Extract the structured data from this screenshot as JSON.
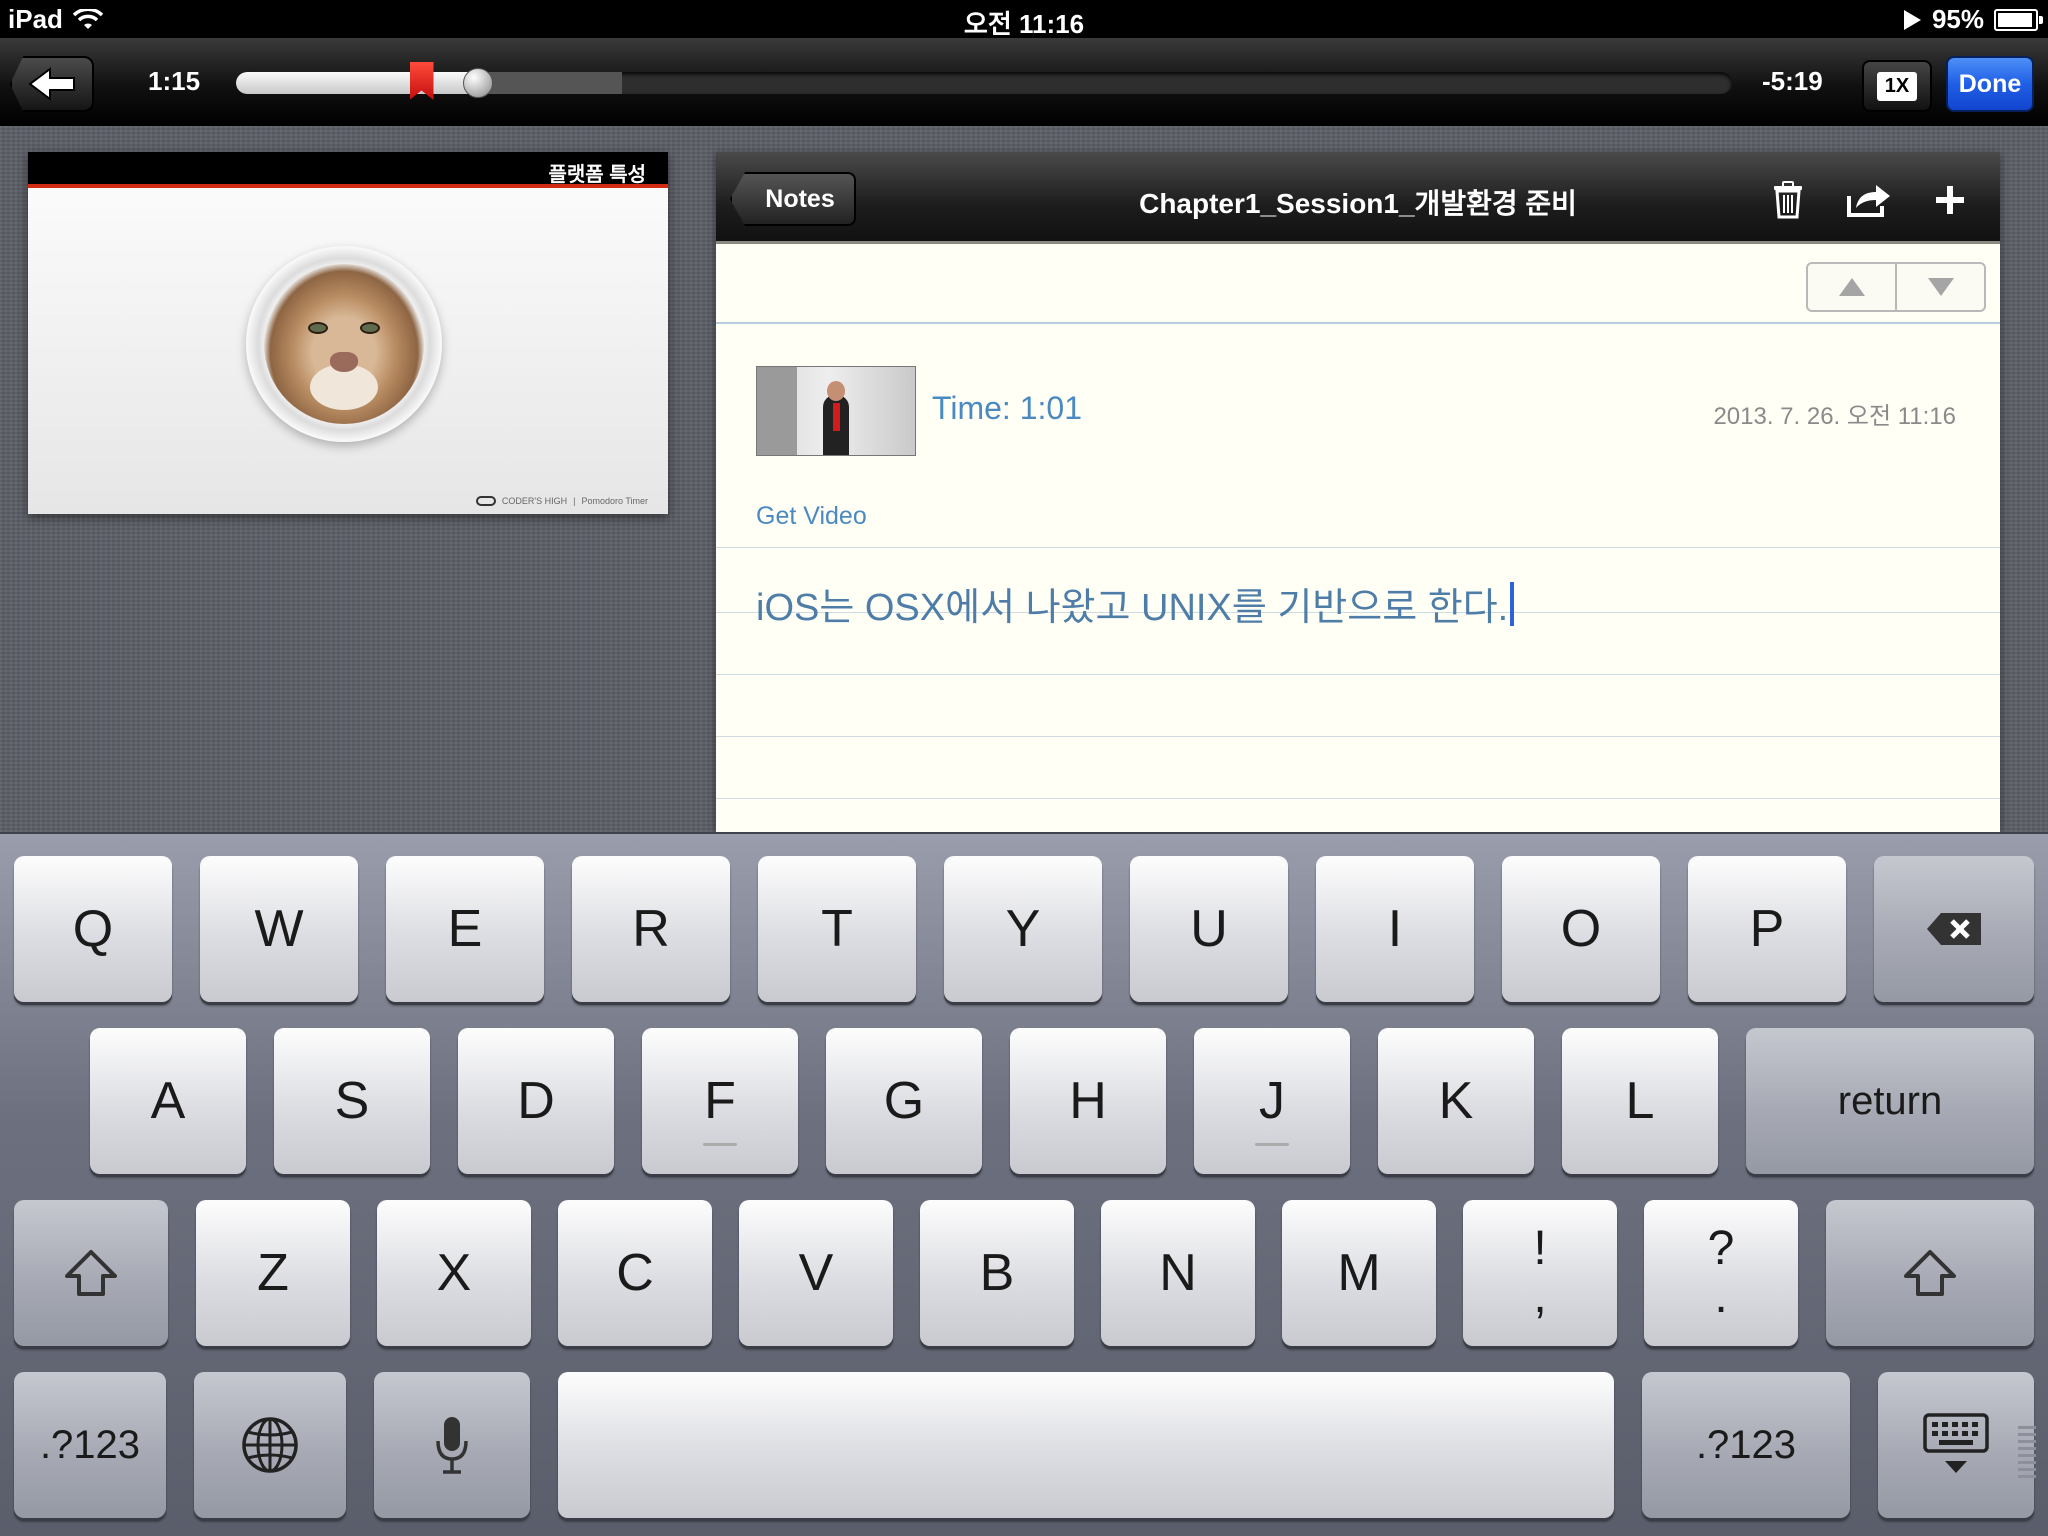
{
  "status_bar": {
    "device": "iPad",
    "time": "오전 11:16",
    "battery": "95%"
  },
  "player": {
    "elapsed": "1:15",
    "remaining": "-5:19",
    "speed": "1X",
    "done_label": "Done",
    "progress_fraction": 0.162,
    "buffered_fraction": 0.258,
    "bookmark_fraction": 0.124
  },
  "slide": {
    "title": "플랫폼 특성",
    "footer_brand": "CODER'S HIGH",
    "footer_sub": "Pomodoro Timer"
  },
  "notes": {
    "back_label": "Notes",
    "title": "Chapter1_Session1_개발환경 준비",
    "entry": {
      "time_label": "Time: 1:01",
      "date": "2013. 7. 26. 오전 11:16",
      "get_video_label": "Get Video",
      "text": "iOS는 OSX에서 나왔고 UNIX를 기반으로 한다."
    }
  },
  "keyboard": {
    "row1": [
      "Q",
      "W",
      "E",
      "R",
      "T",
      "Y",
      "U",
      "I",
      "O",
      "P"
    ],
    "row2": [
      "A",
      "S",
      "D",
      "F",
      "G",
      "H",
      "J",
      "K",
      "L"
    ],
    "return_label": "return",
    "row3": [
      "Z",
      "X",
      "C",
      "V",
      "B",
      "N",
      "M"
    ],
    "punct1_top": "!",
    "punct1_bottom": ",",
    "punct2_top": "?",
    "punct2_bottom": ".",
    "numbers_label": ".?123"
  },
  "colors": {
    "done_button": "#1f5fe6",
    "link_blue": "#4b8ac1",
    "bookmark_red": "#e0231b",
    "caret_blue": "#2f62d8"
  }
}
